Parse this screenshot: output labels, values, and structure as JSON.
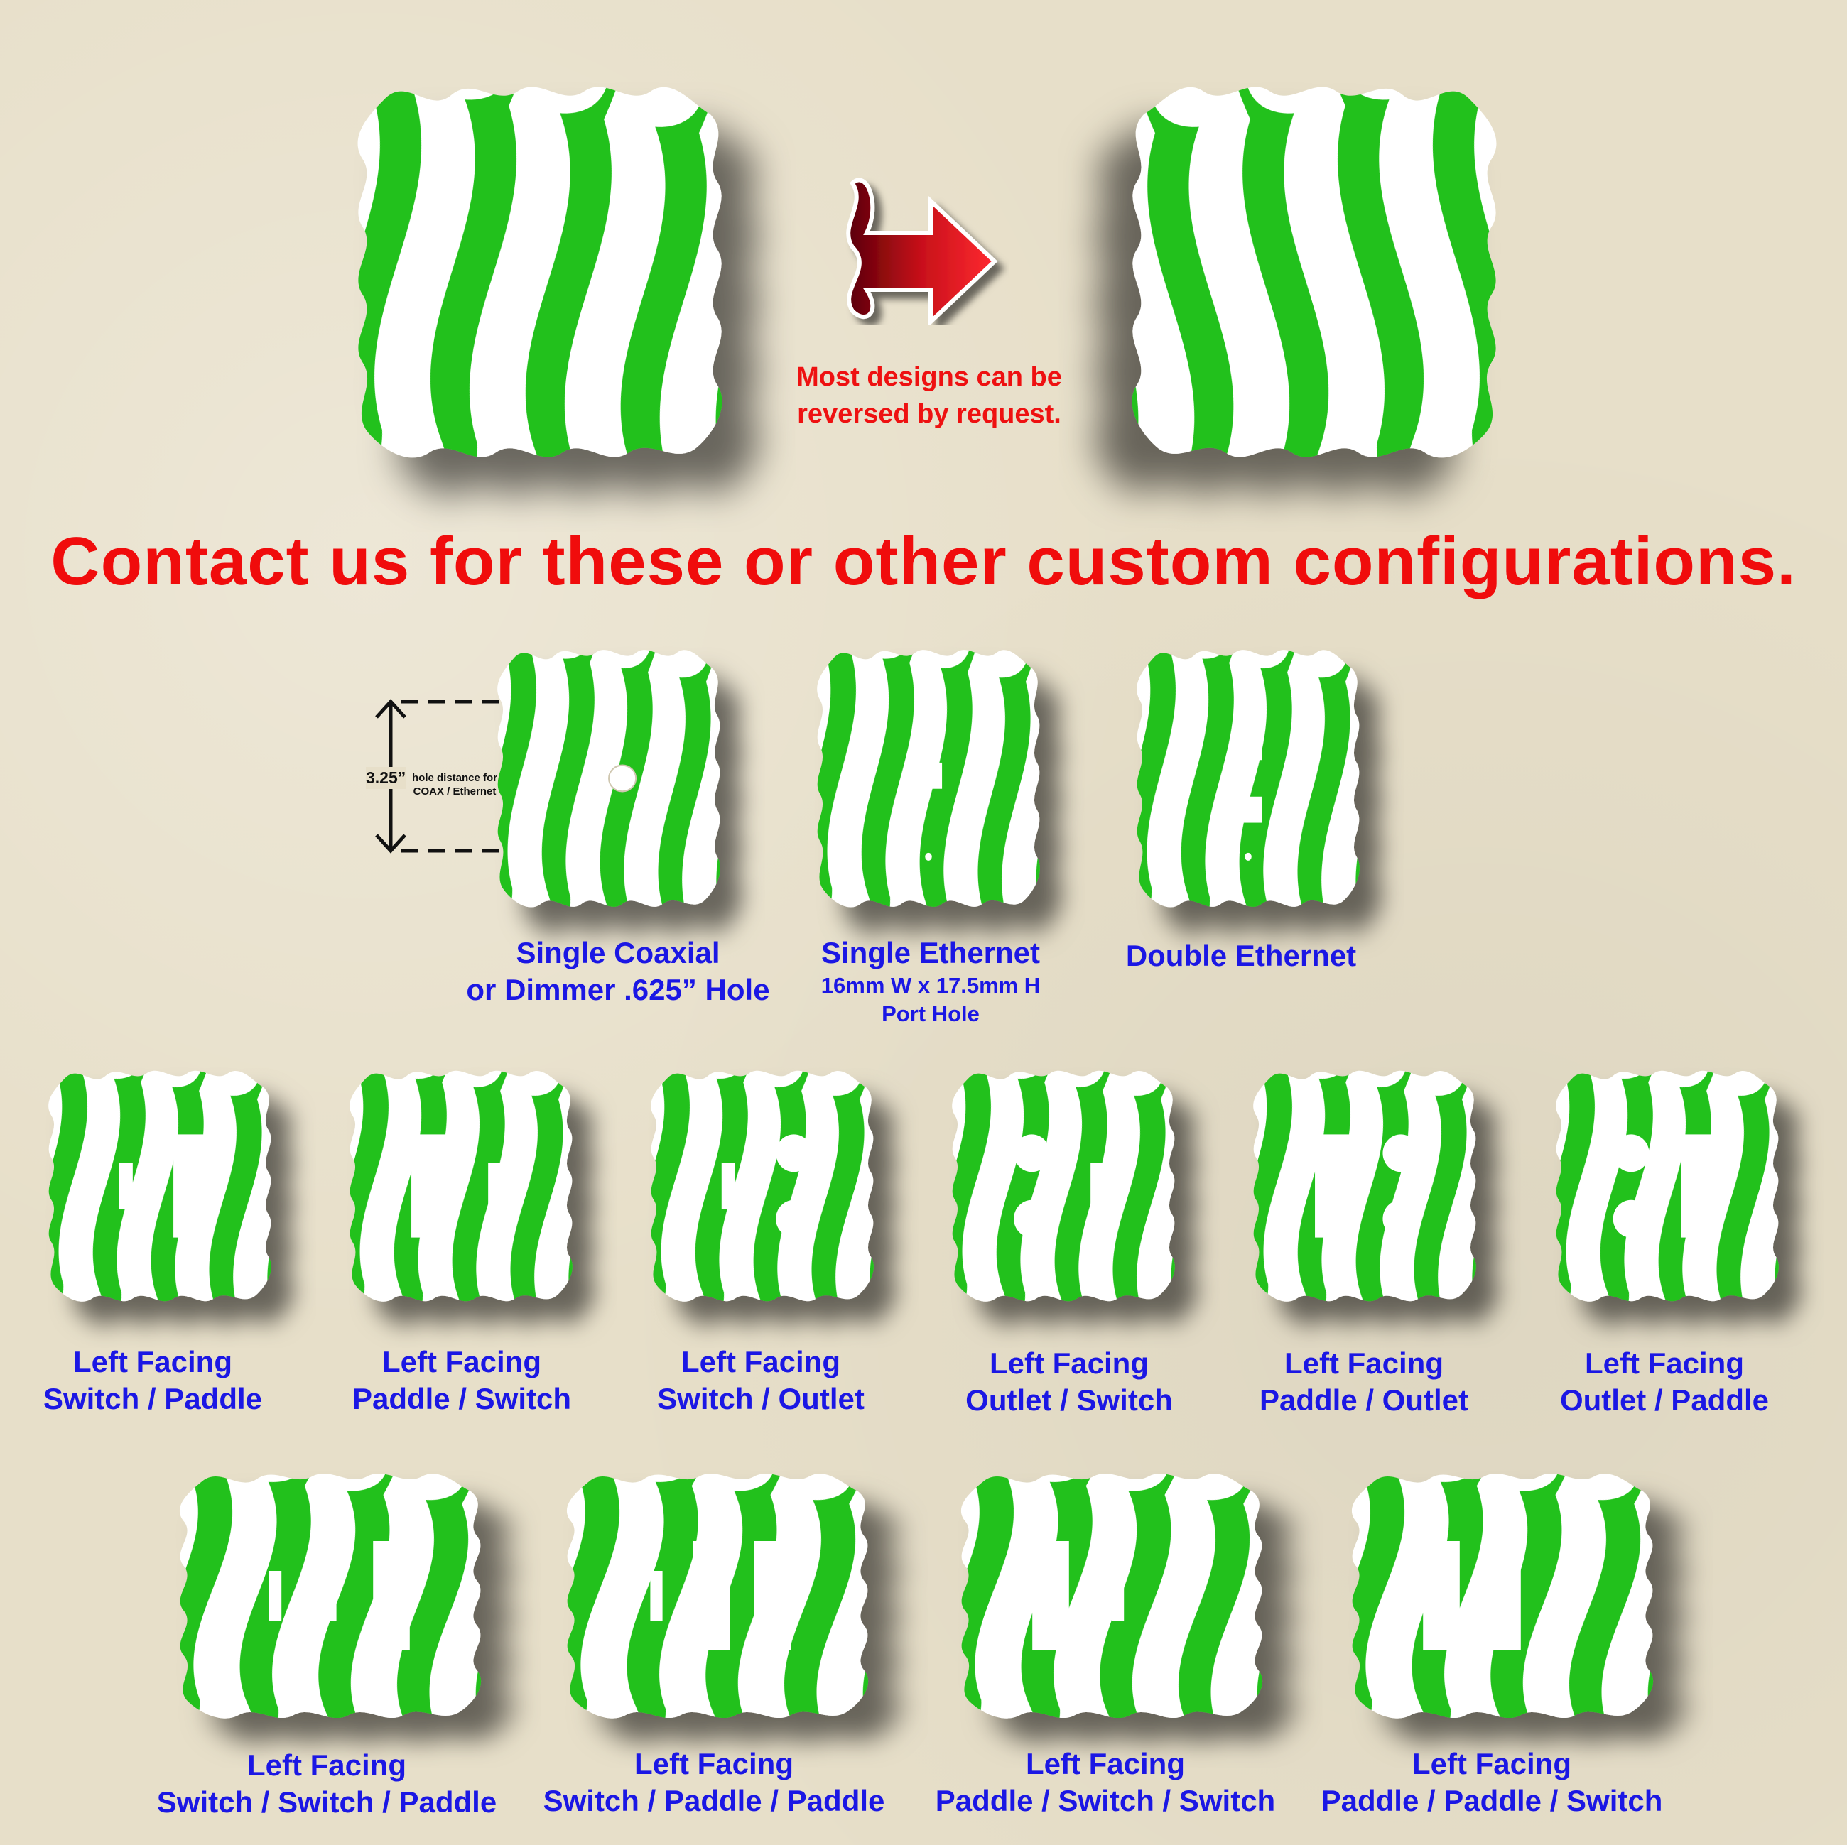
{
  "reverse_note": [
    "Most designs can be",
    "reversed by request."
  ],
  "headline": "Contact us for these or other custom configurations.",
  "dimension": {
    "value": "3.25”",
    "desc_line1": "hole distance for",
    "desc_line2": "COAX / Ethernet"
  },
  "row1": [
    {
      "line1": "Single Coaxial",
      "line2": "or Dimmer .625” Hole"
    },
    {
      "line1": "Single Ethernet",
      "sub1": "16mm W x 17.5mm H",
      "sub2": "Port Hole"
    },
    {
      "line1": "Double Ethernet"
    }
  ],
  "row2": [
    {
      "line1": "Left Facing",
      "line2": "Switch / Paddle"
    },
    {
      "line1": "Left Facing",
      "line2": "Paddle / Switch"
    },
    {
      "line1": "Left Facing",
      "line2": "Switch / Outlet"
    },
    {
      "line1": "Left Facing",
      "line2": "Outlet / Switch"
    },
    {
      "line1": "Left Facing",
      "line2": "Paddle / Outlet"
    },
    {
      "line1": "Left Facing",
      "line2": "Outlet / Paddle"
    }
  ],
  "row3": [
    {
      "line1": "Left Facing",
      "line2": "Switch / Switch / Paddle"
    },
    {
      "line1": "Left Facing",
      "line2": "Switch / Paddle / Paddle"
    },
    {
      "line1": "Left Facing",
      "line2": "Paddle / Switch / Switch"
    },
    {
      "line1": "Left Facing",
      "line2": "Paddle / Paddle / Switch"
    }
  ],
  "colors": {
    "pattern_green": "#22c11c",
    "label_blue": "#1b17e4",
    "headline_red": "#f00c0c",
    "arrow_red": "#c8101a"
  }
}
